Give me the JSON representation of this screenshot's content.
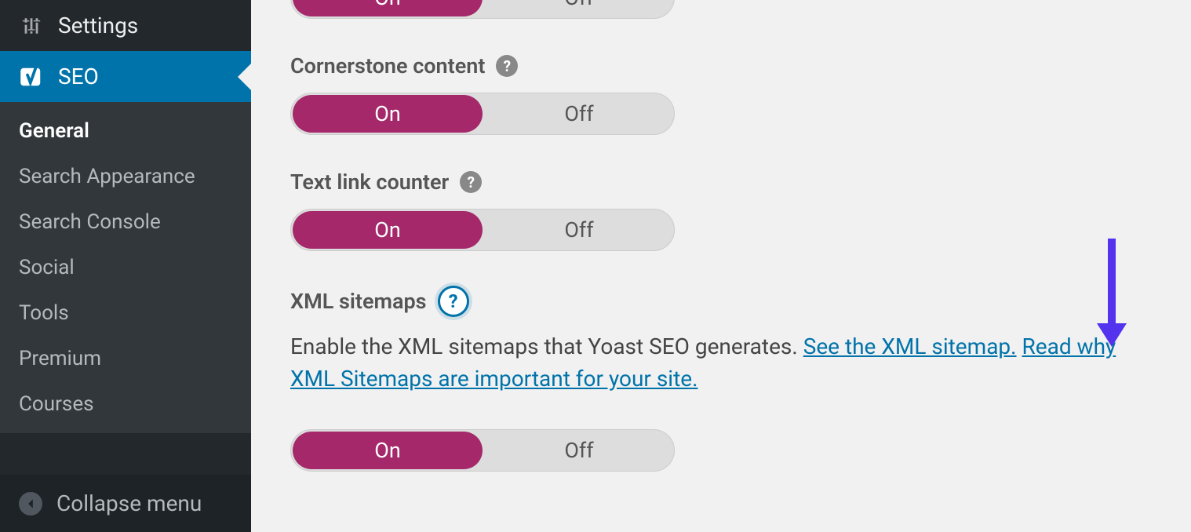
{
  "sidebar": {
    "settings": {
      "label": "Settings"
    },
    "seo": {
      "label": "SEO"
    },
    "submenu": [
      {
        "label": "General",
        "active": true
      },
      {
        "label": "Search Appearance",
        "active": false
      },
      {
        "label": "Search Console",
        "active": false
      },
      {
        "label": "Social",
        "active": false
      },
      {
        "label": "Tools",
        "active": false
      },
      {
        "label": "Premium",
        "active": false
      },
      {
        "label": "Courses",
        "active": false
      }
    ],
    "collapse": {
      "label": "Collapse menu"
    }
  },
  "toggle": {
    "on": "On",
    "off": "Off"
  },
  "sections": {
    "toggle_top": {
      "state": "on"
    },
    "cornerstone": {
      "title": "Cornerstone content",
      "state": "on"
    },
    "textlink": {
      "title": "Text link counter",
      "state": "on"
    },
    "xml": {
      "title": "XML sitemaps",
      "desc_pre": "Enable the XML sitemaps that Yoast SEO generates. ",
      "link1": "See the XML sitemap.",
      "link2": "Read why XML Sitemaps are important for your site.",
      "state": "on"
    }
  }
}
